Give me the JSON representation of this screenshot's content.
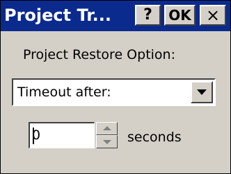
{
  "window": {
    "title": "Project Tr...",
    "help_label": "?",
    "ok_label": "OK",
    "close_label": "×"
  },
  "restore_option": {
    "label": "Project Restore Option:",
    "selected": "Timeout after:"
  },
  "timeout": {
    "value": "0",
    "units_label": "seconds"
  },
  "colors": {
    "titlebar": "#0a2a8e",
    "dialog_background": "#d4d0c8"
  },
  "icons": {
    "combo_dropdown": "chevron-down-icon",
    "spin_up": "spin-up-icon",
    "spin_down": "spin-down-icon"
  }
}
